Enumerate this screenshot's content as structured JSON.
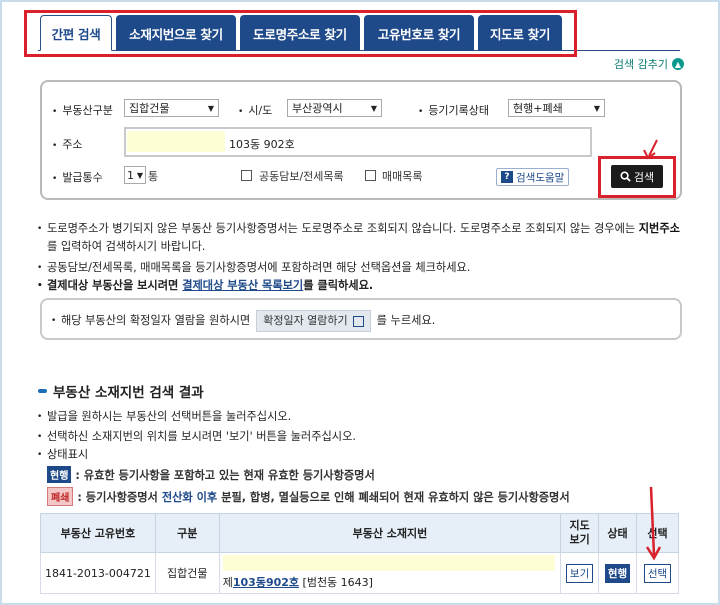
{
  "tabs": [
    {
      "label": "간편 검색",
      "active": true
    },
    {
      "label": "소재지번으로 찾기",
      "active": false
    },
    {
      "label": "도로명주소로 찾기",
      "active": false
    },
    {
      "label": "고유번호로 찾기",
      "active": false
    },
    {
      "label": "지도로 찾기",
      "active": false
    }
  ],
  "collapse_label": "검색 감추기",
  "search": {
    "property_type_label": "부동산구분",
    "property_type_value": "집합건물",
    "region_label": "시/도",
    "region_value": "부산광역시",
    "registry_status_label": "등기기록상태",
    "registry_status_value": "현행+폐쇄",
    "address_label": "주소",
    "address_value": "103동 902호",
    "copies_label": "발급통수",
    "copies_value": "1",
    "copies_unit": "통",
    "collateral_label": "공동담보/전세목록",
    "sales_label": "매매목록",
    "help_label": "검색도움말",
    "search_button": "검색"
  },
  "notices": {
    "n1_part1": "도로명주소가 병기되지 않은 부동산 등기사항증명서는 도로명주소로 조회되지 않습니다. 도로명주소로 조회되지 않는 경우에는 ",
    "n1_bold": "지번주소",
    "n1_part2": "를 입력하여 검색하시기 바랍니다.",
    "n2": "공동담보/전세목록, 매매목록을 등기사항증명서에 포함하려면 해당 선택옵션을 체크하세요.",
    "n3_part1": "결제대상 부동산을 보시려면 ",
    "n3_link": "결제대상 부동산 목록보기",
    "n3_part2": "를 클릭하세요.",
    "info_part1": "해당 부동산의 확정일자 열람을 원하시면",
    "info_button": "확정일자 열람하기",
    "info_part2": "를 누르세요."
  },
  "results": {
    "title": "부동산 소재지번 검색 결과",
    "b1": "발급을 원하시는 부동산의 선택버튼을 눌러주십시오.",
    "b2": "선택하신 소재지번의 위치를 보시려면 '보기' 버튼을 눌러주십시오.",
    "b3": "상태표시",
    "status1_badge": "현행",
    "status1_text": ": 유효한 등기사항을 포함하고 있는 현재 유효한 등기사항증명서",
    "status2_badge": "폐쇄",
    "status2_text_a": ": 등기사항증명서 ",
    "status2_text_link": "전산화 이후",
    "status2_text_b": " 분필, 합병, 멸실등으로 인해 폐쇄되어 현재 유효하지 않은 등기사항증명서",
    "headers": [
      "부동산 고유번호",
      "구분",
      "부동산 소재지번",
      "지도\n보기",
      "상태",
      "선택"
    ],
    "row": {
      "id": "1841-2013-004721",
      "type": "집합건물",
      "address_prefix": "제",
      "address_link": "103동902호",
      "address_suffix": " [범천동 1643]",
      "map_button": "보기",
      "status": "현행",
      "select_button": "선택"
    }
  },
  "colors": {
    "accent": "#1e4a8a",
    "highlight": "#d9202b",
    "teal": "#0b9a8e"
  }
}
